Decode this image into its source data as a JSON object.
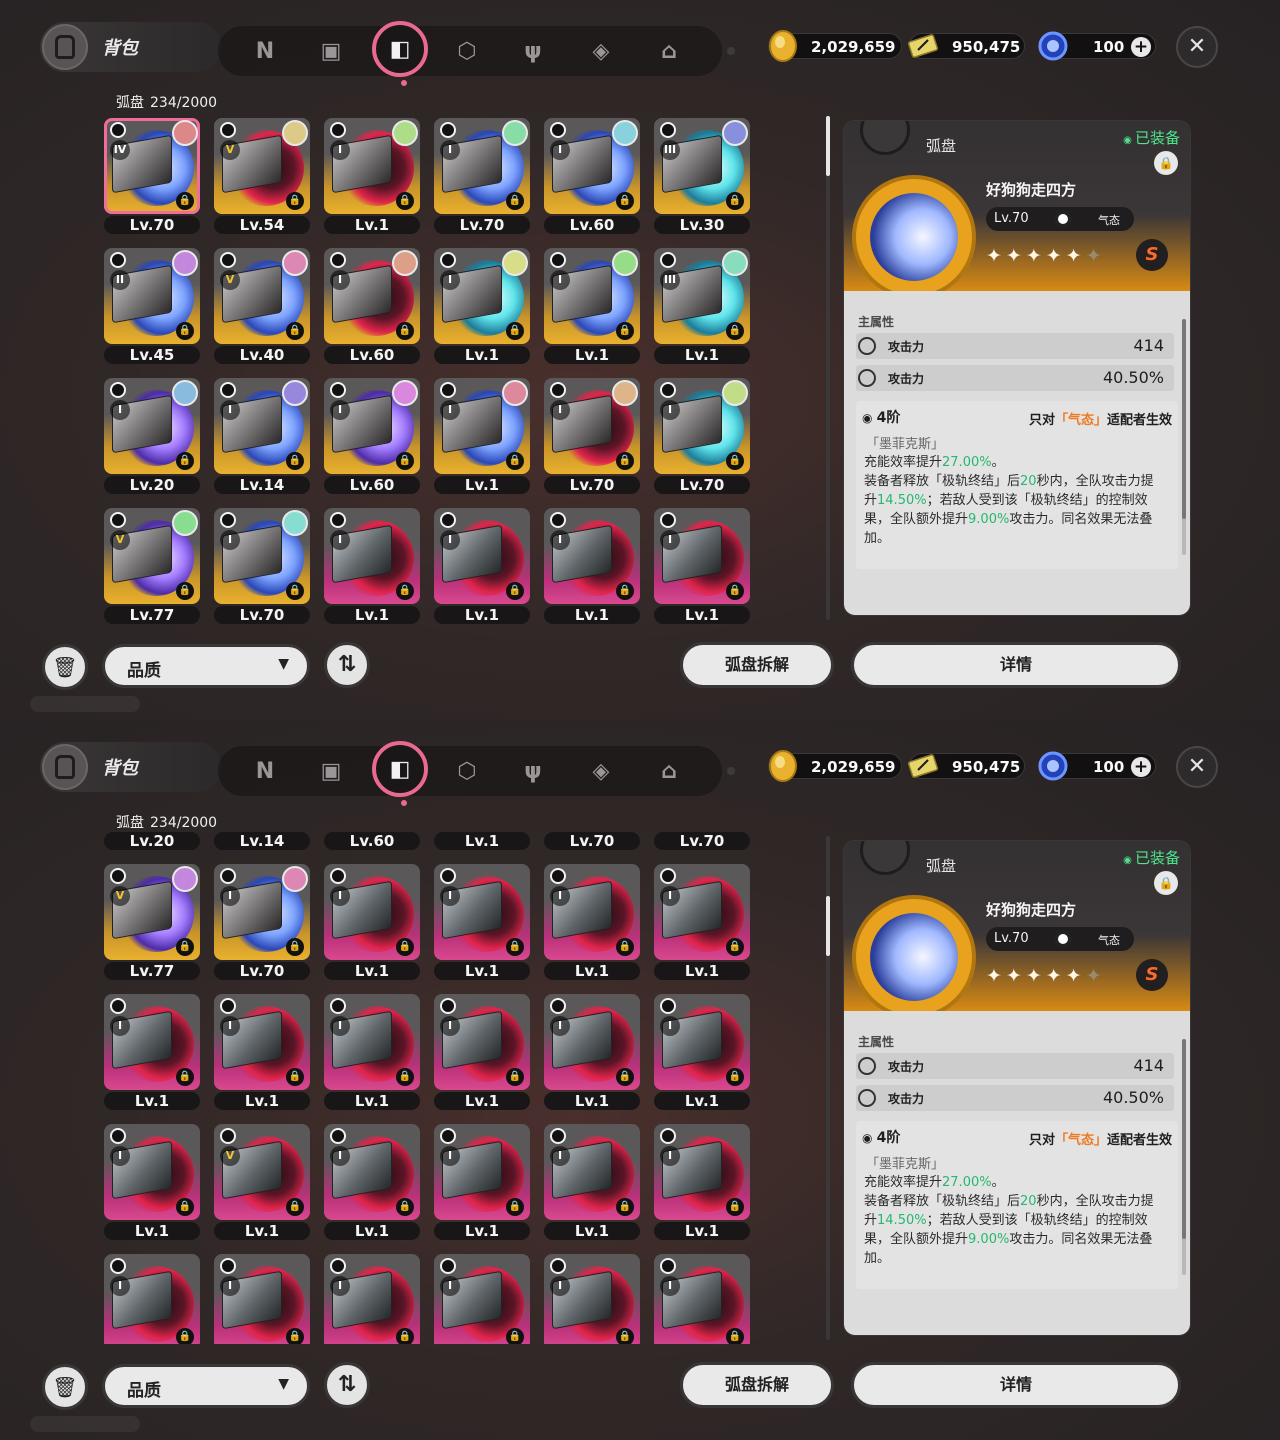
{
  "header": {
    "bag_label": "背包",
    "nav_icons": [
      "n-logo-icon",
      "handheld-icon",
      "disc-case-icon",
      "cube-icon",
      "fork-knife-icon",
      "shield-s-icon",
      "home-icon"
    ],
    "active_nav": "disc-case-icon",
    "currencies": [
      {
        "icon": "gold-coin-icon",
        "value": "2,029,659",
        "color": "#e8b12e"
      },
      {
        "icon": "ticket-icon",
        "value": "950,475",
        "color": "#e7d46a"
      },
      {
        "icon": "energy-orb-icon",
        "value": "100",
        "color": "#4d7bff"
      }
    ],
    "close_label": "✕"
  },
  "inventory": {
    "label": "弧盘",
    "count": "234/2000"
  },
  "detail": {
    "tag": "弧盘",
    "equipped": "已装备",
    "name": "好狗狗走四方",
    "level": "Lv.70",
    "attribute": "气态",
    "stars_filled": 5,
    "stars_total": 6,
    "rank": "S",
    "main_attr_title": "主属性",
    "stats": [
      {
        "name": "攻击力",
        "value": "414"
      },
      {
        "name": "攻击力",
        "value": "40.50%"
      }
    ],
    "set_tier": "4阶",
    "set_req_prefix": "只对",
    "set_req_highlight": "「气态」",
    "set_req_suffix": "适配者生效",
    "set_name": "「墨菲克斯」",
    "set_desc_parts": [
      {
        "t": "充能效率提升",
        "g": false
      },
      {
        "t": "27.00%",
        "g": true
      },
      {
        "t": "。\n装备者释放「极轨终结」后",
        "g": false
      },
      {
        "t": "20",
        "g": true
      },
      {
        "t": "秒内，全队攻击力提升",
        "g": false
      },
      {
        "t": "14.50%",
        "g": true
      },
      {
        "t": "；若敌人受到该「极轨终结」的控制效果，全队额外提升",
        "g": false
      },
      {
        "t": "9.00%",
        "g": true
      },
      {
        "t": "攻击力。同名效果无法叠加。",
        "g": false
      }
    ]
  },
  "footer": {
    "filter_label": "品质",
    "dismantle_label": "弧盘拆解",
    "details_label": "详情"
  },
  "grid_panel1": [
    [
      {
        "lv": "Lv.70",
        "r": "IV",
        "c": "gold",
        "a": "blue",
        "sel": true
      },
      {
        "lv": "Lv.54",
        "r": "V",
        "c": "gold",
        "a": "red"
      },
      {
        "lv": "Lv.1",
        "r": "I",
        "c": "gold",
        "a": "red"
      },
      {
        "lv": "Lv.70",
        "r": "I",
        "c": "gold",
        "a": "blue"
      },
      {
        "lv": "Lv.60",
        "r": "I",
        "c": "gold",
        "a": "blue"
      },
      {
        "lv": "Lv.30",
        "r": "III",
        "c": "gold",
        "a": "cyan"
      }
    ],
    [
      {
        "lv": "Lv.45",
        "r": "II",
        "c": "gold",
        "a": "blue"
      },
      {
        "lv": "Lv.40",
        "r": "V",
        "c": "gold",
        "a": "blue"
      },
      {
        "lv": "Lv.60",
        "r": "I",
        "c": "gold",
        "a": "red"
      },
      {
        "lv": "Lv.1",
        "r": "I",
        "c": "gold",
        "a": "cyan"
      },
      {
        "lv": "Lv.1",
        "r": "I",
        "c": "gold",
        "a": "blue"
      },
      {
        "lv": "Lv.1",
        "r": "III",
        "c": "gold",
        "a": "cyan"
      }
    ],
    [
      {
        "lv": "Lv.20",
        "r": "I",
        "c": "gold",
        "a": "purple"
      },
      {
        "lv": "Lv.14",
        "r": "I",
        "c": "gold",
        "a": "blue"
      },
      {
        "lv": "Lv.60",
        "r": "I",
        "c": "gold",
        "a": "purple"
      },
      {
        "lv": "Lv.1",
        "r": "I",
        "c": "gold",
        "a": "blue"
      },
      {
        "lv": "Lv.70",
        "r": "I",
        "c": "gold",
        "a": "red"
      },
      {
        "lv": "Lv.70",
        "r": "I",
        "c": "gold",
        "a": "cyan"
      }
    ],
    [
      {
        "lv": "Lv.77",
        "r": "V",
        "c": "gold",
        "a": "purple"
      },
      {
        "lv": "Lv.70",
        "r": "I",
        "c": "gold",
        "a": "blue"
      },
      {
        "lv": "Lv.1",
        "r": "I",
        "c": "pink",
        "a": "red"
      },
      {
        "lv": "Lv.1",
        "r": "I",
        "c": "pink",
        "a": "red"
      },
      {
        "lv": "Lv.1",
        "r": "I",
        "c": "pink",
        "a": "red"
      },
      {
        "lv": "Lv.1",
        "r": "I",
        "c": "pink",
        "a": "red"
      }
    ]
  ],
  "grid_panel2": [
    [
      {
        "lv": "Lv.20",
        "r": "",
        "c": "gold",
        "a": "purple"
      },
      {
        "lv": "Lv.14",
        "r": "",
        "c": "gold",
        "a": "blue"
      },
      {
        "lv": "Lv.60",
        "r": "",
        "c": "gold",
        "a": "purple"
      },
      {
        "lv": "Lv.1",
        "r": "",
        "c": "gold",
        "a": "blue"
      },
      {
        "lv": "Lv.70",
        "r": "",
        "c": "gold",
        "a": "red"
      },
      {
        "lv": "Lv.70",
        "r": "",
        "c": "gold",
        "a": "cyan"
      }
    ],
    [
      {
        "lv": "Lv.77",
        "r": "V",
        "c": "gold",
        "a": "purple"
      },
      {
        "lv": "Lv.70",
        "r": "I",
        "c": "gold",
        "a": "blue"
      },
      {
        "lv": "Lv.1",
        "r": "I",
        "c": "pink",
        "a": "red"
      },
      {
        "lv": "Lv.1",
        "r": "I",
        "c": "pink",
        "a": "red"
      },
      {
        "lv": "Lv.1",
        "r": "I",
        "c": "pink",
        "a": "red"
      },
      {
        "lv": "Lv.1",
        "r": "I",
        "c": "pink",
        "a": "red"
      }
    ],
    [
      {
        "lv": "Lv.1",
        "r": "I",
        "c": "pink",
        "a": "red"
      },
      {
        "lv": "Lv.1",
        "r": "I",
        "c": "pink",
        "a": "red"
      },
      {
        "lv": "Lv.1",
        "r": "I",
        "c": "pink",
        "a": "red"
      },
      {
        "lv": "Lv.1",
        "r": "I",
        "c": "pink",
        "a": "red"
      },
      {
        "lv": "Lv.1",
        "r": "I",
        "c": "pink",
        "a": "red"
      },
      {
        "lv": "Lv.1",
        "r": "I",
        "c": "pink",
        "a": "red"
      }
    ],
    [
      {
        "lv": "Lv.1",
        "r": "I",
        "c": "pink",
        "a": "red"
      },
      {
        "lv": "Lv.1",
        "r": "V",
        "c": "pink",
        "a": "red"
      },
      {
        "lv": "Lv.1",
        "r": "I",
        "c": "pink",
        "a": "red"
      },
      {
        "lv": "Lv.1",
        "r": "I",
        "c": "pink",
        "a": "red"
      },
      {
        "lv": "Lv.1",
        "r": "I",
        "c": "pink",
        "a": "red"
      },
      {
        "lv": "Lv.1",
        "r": "I",
        "c": "pink",
        "a": "red"
      }
    ],
    [
      {
        "lv": "",
        "r": "I",
        "c": "pink",
        "a": "red"
      },
      {
        "lv": "",
        "r": "I",
        "c": "pink",
        "a": "red"
      },
      {
        "lv": "",
        "r": "I",
        "c": "pink",
        "a": "red"
      },
      {
        "lv": "",
        "r": "I",
        "c": "pink",
        "a": "red"
      },
      {
        "lv": "",
        "r": "I",
        "c": "pink",
        "a": "red"
      },
      {
        "lv": "",
        "r": "I",
        "c": "pink",
        "a": "red"
      }
    ]
  ]
}
